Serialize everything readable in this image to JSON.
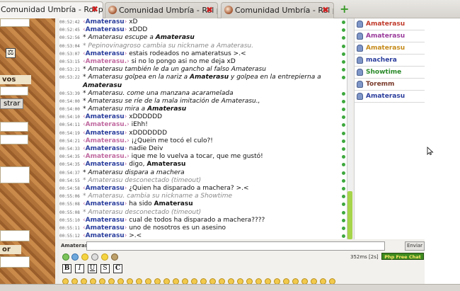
{
  "tabs": [
    {
      "label": "Comunidad Umbría - Rol p...",
      "active": true
    },
    {
      "label": "Comunidad Umbría - Rol p...",
      "active": false
    },
    {
      "label": "Comunidad Umbría - Rol p...",
      "active": false
    }
  ],
  "left_panel": {
    "vos_label": "vos",
    "button_label": "strar",
    "or_label": "or"
  },
  "chat": {
    "lines": [
      {
        "ts": "00:52:42",
        "nick": "Amaterasu",
        "msg": " xD"
      },
      {
        "ts": "00:52:45",
        "nick": "Amaterasu",
        "msg": " xDDD"
      },
      {
        "ts": "00:52:56",
        "pre": "* Amaterasu escupe a ",
        "bold": "Amaterasu",
        "post": ""
      },
      {
        "ts": "00:53:04",
        "sys": "* Pepinovinagroso cambia su nickname a Amaterasu."
      },
      {
        "ts": "00:53:07",
        "nick": "Amaterasu",
        "msg": " estais rodeados no amateratsus >.<"
      },
      {
        "ts": "00:53:15",
        "nick": "Amaterasu.",
        "msg": " si no lo pongo asi no me deja xD"
      },
      {
        "ts": "00:53:21",
        "pre": "* Amaterasu también le da un gancho al falso Amaterasu",
        "bold": "",
        "post": ""
      },
      {
        "ts": "00:53:22",
        "pre": "* Amaterasu golpea en la nariz a ",
        "bold": "Amaterasu",
        "post": " y golpea en la entrepierna a"
      },
      {
        "ts": "",
        "pre": "",
        "bold": "Amaterasu",
        "post": ""
      },
      {
        "ts": "00:53:39",
        "pre": "* Amaterasu. come una manzana acaramelada",
        "bold": "",
        "post": ""
      },
      {
        "ts": "00:54:00",
        "pre": "* Amaterasu se ríe de la mala imitación de Amaterasu.,",
        "bold": "",
        "post": ""
      },
      {
        "ts": "00:54:00",
        "pre": "* Amaterasu mira a ",
        "bold": "Amaterasu",
        "post": ""
      },
      {
        "ts": "00:54:10",
        "nick": "Amaterasu",
        "msg": " xDDDDDD"
      },
      {
        "ts": "00:54:11",
        "nick": "Amaterasu.",
        "msg": " iEhh!"
      },
      {
        "ts": "00:54:19",
        "nick": "Amaterasu",
        "msg": " xDDDDDDD"
      },
      {
        "ts": "00:54:21",
        "nick": "Amaterasu.",
        "msg": " ¡¿Quein me tocó el culo?!"
      },
      {
        "ts": "00:54:33",
        "nick": "Amaterasu",
        "msg": " nadie Deiv"
      },
      {
        "ts": "00:54:35",
        "nick": "Amaterasu.",
        "msg": " ique me lo vuelva a tocar, que me gustó!"
      },
      {
        "ts": "00:54:35",
        "nick": "Amaterasu",
        "msg": " digo, ",
        "msgbold": "Amaterasu"
      },
      {
        "ts": "00:54:37",
        "pre": "* Amaterasu dispara a machera",
        "bold": "",
        "post": ""
      },
      {
        "ts": "00:54:55",
        "sys": "* Amaterasu desconectado (timeout)"
      },
      {
        "ts": "00:54:58",
        "nick": "Amaterasu",
        "msg": " ¿Quien ha disparado a machera? >.<"
      },
      {
        "ts": "00:55:06",
        "sys": "* Amaterasu. cambia su nickname a Showtime"
      },
      {
        "ts": "00:55:08",
        "nick": "Amaterasu",
        "msg": " ha sido ",
        "msgbold": "Amaterasu"
      },
      {
        "ts": "00:55:08",
        "sys": "* Amaterasu desconectado (timeout)"
      },
      {
        "ts": "00:55:10",
        "nick": "Amaterasu",
        "msg": " cual de todos ha disparado a machera????"
      },
      {
        "ts": "00:55:11",
        "nick": "Amaterasu",
        "msg": " uno de nosotros es un asesino"
      },
      {
        "ts": "00:55:12",
        "nick": "Amaterasu",
        "msg": " >.<"
      }
    ]
  },
  "users": [
    {
      "name": "Amaterasu",
      "color": "#c03a2a"
    },
    {
      "name": "Amaterasu",
      "color": "#9a3a9a"
    },
    {
      "name": "Amaterasu",
      "color": "#c58a1a"
    },
    {
      "name": "machera",
      "color": "#2a3d9c"
    },
    {
      "name": "Showtime",
      "color": "#2a8a2a"
    },
    {
      "name": "Toremm",
      "color": "#7a3a2a"
    },
    {
      "name": "Amaterasu",
      "color": "#2a3d9c"
    }
  ],
  "input": {
    "nickname": "Amaterasu",
    "message": "",
    "send_label": "Enviar"
  },
  "toolbar": {
    "bold": "B",
    "italic": "I",
    "underline": "U",
    "strike": "S",
    "color": "C",
    "ping": "352ms [2s]",
    "badge": "Php Free Chat"
  }
}
